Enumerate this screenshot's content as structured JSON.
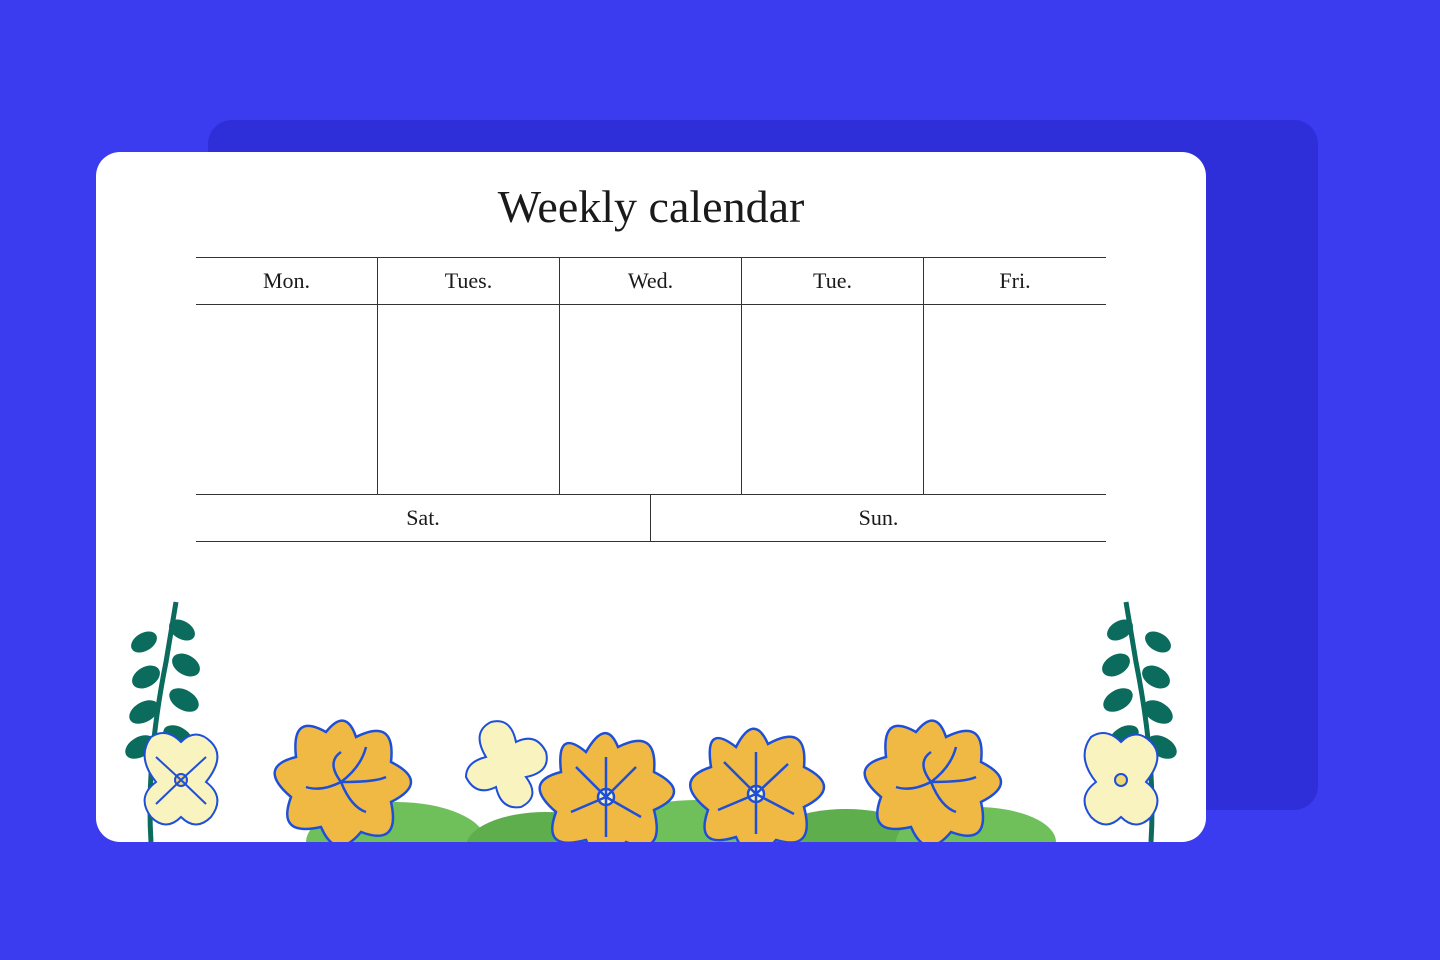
{
  "title": "Weekly calendar",
  "weekdays": [
    "Mon.",
    "Tues.",
    "Wed.",
    "Tue.",
    "Fri."
  ],
  "weekend": [
    "Sat.",
    "Sun."
  ],
  "colors": {
    "background": "#3B3BEF",
    "shadow": "#2F2FD9",
    "card": "#ffffff",
    "text": "#1a1a1a",
    "flower_yellow": "#F0B943",
    "flower_pale": "#F9F3BF",
    "leaf_dark": "#0B6B5C",
    "leaf_light": "#6FBF5B",
    "outline": "#1E4FD9"
  }
}
